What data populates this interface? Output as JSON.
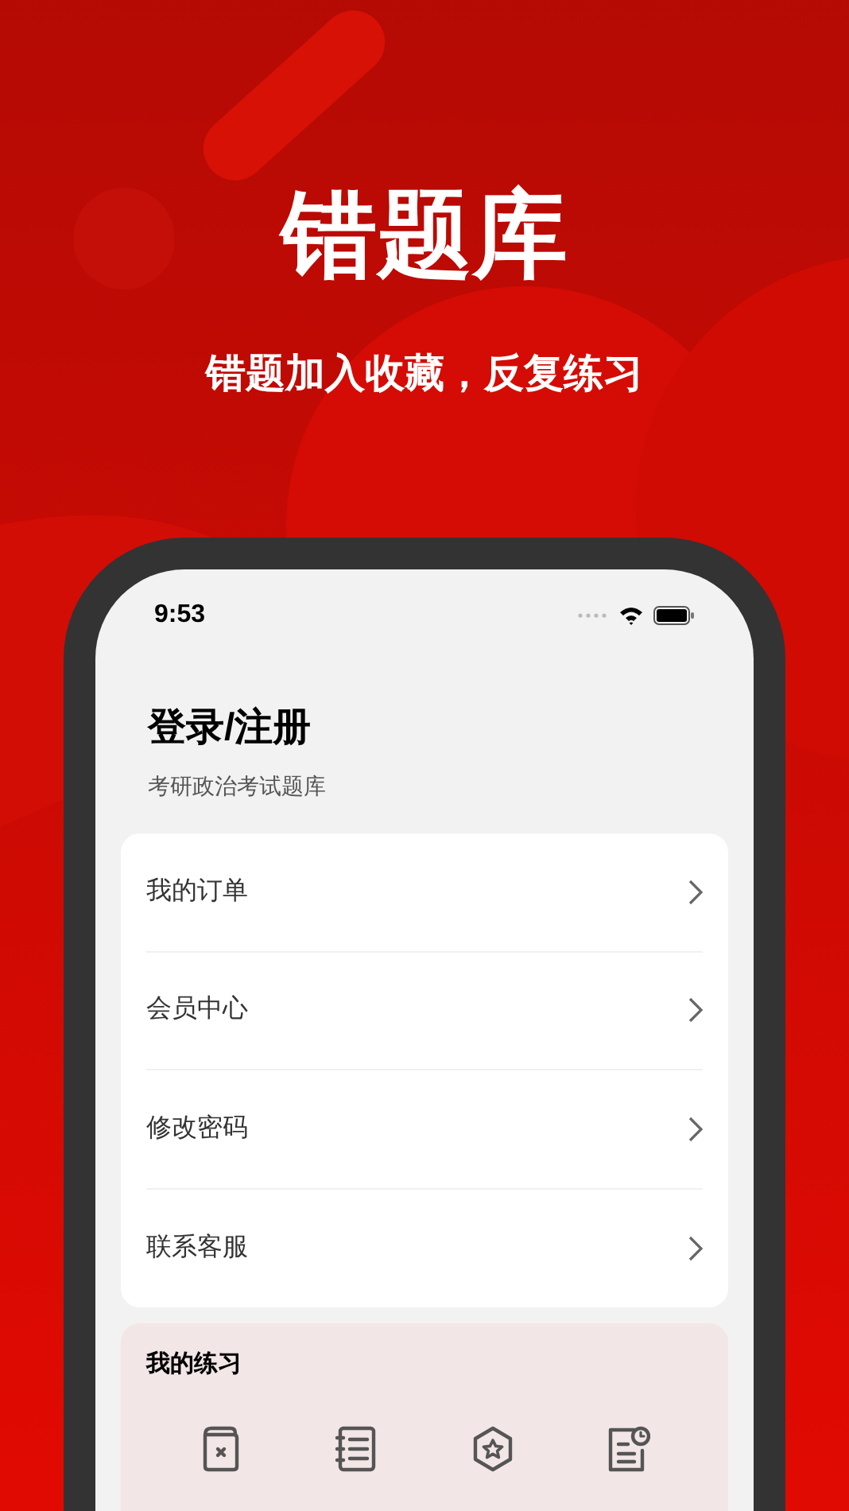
{
  "headline": "错题库",
  "tagline": "错题加入收藏，反复练习",
  "status_bar": {
    "time": "9:53"
  },
  "profile": {
    "title": "登录/注册",
    "subtitle": "考研政治考试题库"
  },
  "menu": [
    {
      "label": "我的订单"
    },
    {
      "label": "会员中心"
    },
    {
      "label": "修改密码"
    },
    {
      "label": "联系客服"
    }
  ],
  "practice": {
    "title": "我的练习",
    "items": [
      {
        "kind": "wrong"
      },
      {
        "kind": "list"
      },
      {
        "kind": "favorite"
      },
      {
        "kind": "history"
      }
    ]
  }
}
